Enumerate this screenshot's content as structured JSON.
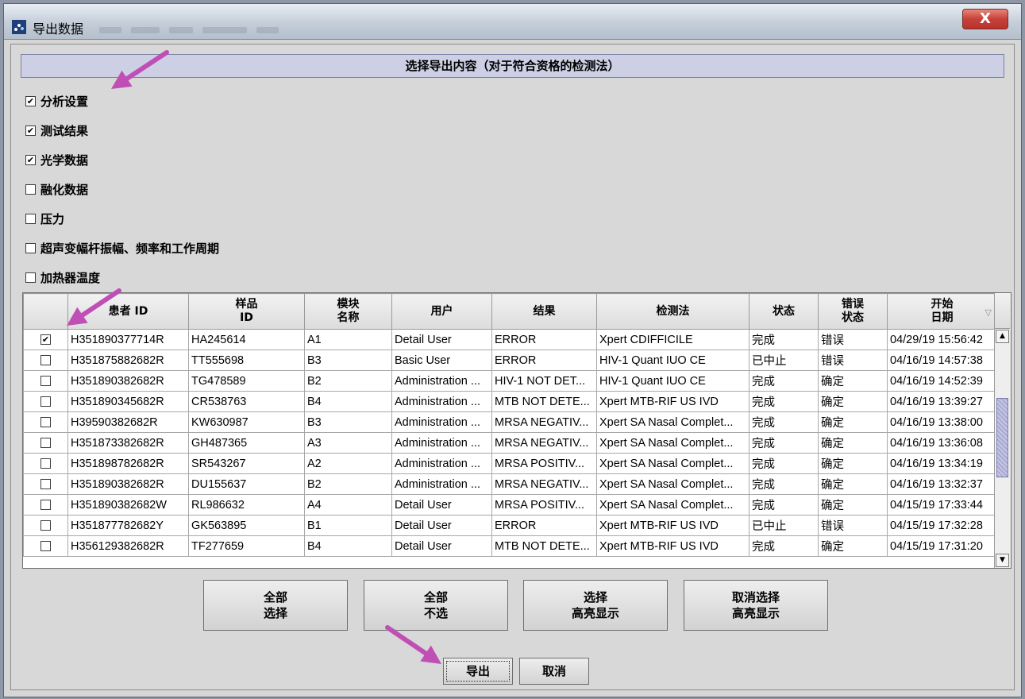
{
  "window": {
    "title": "导出数据",
    "close_label": "X"
  },
  "header": {
    "title": "选择导出内容（对于符合资格的检测法）"
  },
  "options": [
    {
      "label": "分析设置",
      "checked": true
    },
    {
      "label": "测试结果",
      "checked": true
    },
    {
      "label": "光学数据",
      "checked": true
    },
    {
      "label": "融化数据",
      "checked": false
    },
    {
      "label": "压力",
      "checked": false
    },
    {
      "label": "超声变幅杆振幅、频率和工作周期",
      "checked": false
    },
    {
      "label": "加热器温度",
      "checked": false
    }
  ],
  "table": {
    "columns": [
      "",
      "患者 ID",
      "样品\nID",
      "模块\n名称",
      "用户",
      "结果",
      "检测法",
      "状态",
      "错误\n状态",
      "开始\n日期"
    ],
    "rows": [
      {
        "checked": true,
        "patient": "H351890377714R",
        "sample": "HA245614",
        "module": "A1",
        "user": "Detail User",
        "result": "ERROR",
        "assay": "Xpert CDIFFICILE",
        "status": "完成",
        "error": "错误",
        "date": "04/29/19 15:56:42"
      },
      {
        "checked": false,
        "patient": "H351875882682R",
        "sample": "TT555698",
        "module": "B3",
        "user": "Basic User",
        "result": "ERROR",
        "assay": "HIV-1 Quant IUO CE",
        "status": "已中止",
        "error": "错误",
        "date": "04/16/19 14:57:38"
      },
      {
        "checked": false,
        "patient": "H351890382682R",
        "sample": "TG478589",
        "module": "B2",
        "user": "Administration ...",
        "result": "HIV-1 NOT DET...",
        "assay": "HIV-1 Quant IUO CE",
        "status": "完成",
        "error": "确定",
        "date": "04/16/19 14:52:39"
      },
      {
        "checked": false,
        "patient": "H351890345682R",
        "sample": "CR538763",
        "module": "B4",
        "user": "Administration ...",
        "result": "MTB NOT DETE...",
        "assay": "Xpert MTB-RIF US IVD",
        "status": "完成",
        "error": "确定",
        "date": "04/16/19 13:39:27"
      },
      {
        "checked": false,
        "patient": "H39590382682R",
        "sample": "KW630987",
        "module": "B3",
        "user": "Administration ...",
        "result": "MRSA NEGATIV...",
        "assay": "Xpert SA Nasal Complet...",
        "status": "完成",
        "error": "确定",
        "date": "04/16/19 13:38:00"
      },
      {
        "checked": false,
        "patient": "H351873382682R",
        "sample": "GH487365",
        "module": "A3",
        "user": "Administration ...",
        "result": "MRSA NEGATIV...",
        "assay": "Xpert SA Nasal Complet...",
        "status": "完成",
        "error": "确定",
        "date": "04/16/19 13:36:08"
      },
      {
        "checked": false,
        "patient": "H351898782682R",
        "sample": "SR543267",
        "module": "A2",
        "user": "Administration ...",
        "result": "MRSA POSITIV...",
        "assay": "Xpert SA Nasal Complet...",
        "status": "完成",
        "error": "确定",
        "date": "04/16/19 13:34:19"
      },
      {
        "checked": false,
        "patient": "H351890382682R",
        "sample": "DU155637",
        "module": "B2",
        "user": "Administration ...",
        "result": "MRSA NEGATIV...",
        "assay": "Xpert SA Nasal Complet...",
        "status": "完成",
        "error": "确定",
        "date": "04/16/19 13:32:37"
      },
      {
        "checked": false,
        "patient": "H351890382682W",
        "sample": "RL986632",
        "module": "A4",
        "user": "Detail User",
        "result": "MRSA POSITIV...",
        "assay": "Xpert SA Nasal Complet...",
        "status": "完成",
        "error": "确定",
        "date": "04/15/19 17:33:44"
      },
      {
        "checked": false,
        "patient": "H351877782682Y",
        "sample": "GK563895",
        "module": "B1",
        "user": "Detail User",
        "result": "ERROR",
        "assay": "Xpert MTB-RIF US IVD",
        "status": "已中止",
        "error": "错误",
        "date": "04/15/19 17:32:28"
      },
      {
        "checked": false,
        "patient": "H356129382682R",
        "sample": "TF277659",
        "module": "B4",
        "user": "Detail User",
        "result": "MTB NOT DETE...",
        "assay": "Xpert MTB-RIF US IVD",
        "status": "完成",
        "error": "确定",
        "date": "04/15/19 17:31:20"
      }
    ]
  },
  "buttons": {
    "select_all": "全部\n选择",
    "deselect_all": "全部\n不选",
    "select_highlighted": "选择\n高亮显示",
    "deselect_highlighted": "取消选择\n高亮显示",
    "export": "导出",
    "cancel": "取消"
  },
  "colors": {
    "annotation_arrow": "#c04fb5",
    "header_band": "#cdd0e4",
    "close_button": "#c5423a"
  },
  "icons": {
    "app": "app-logo-icon",
    "close": "close-icon",
    "sort": "sort-triangle-icon"
  }
}
